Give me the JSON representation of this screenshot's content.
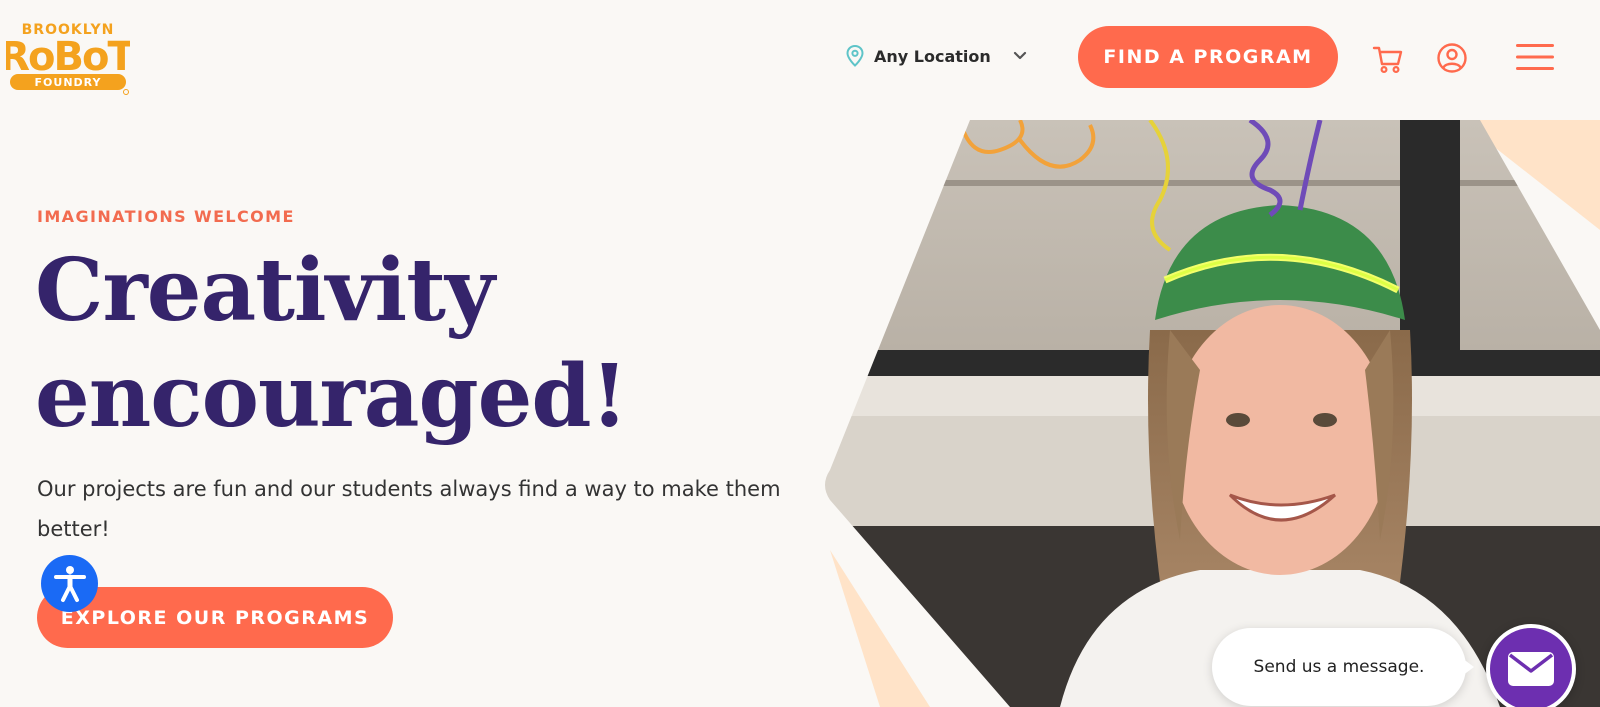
{
  "header": {
    "logo_text": "BROOKLYN ROBOT FOUNDRY",
    "location_label": "Any Location",
    "cta_label": "FIND A PROGRAM",
    "icons": [
      "map-pin-icon",
      "chevron-down-icon",
      "cart-icon",
      "user-icon",
      "hamburger-menu-icon"
    ]
  },
  "hero": {
    "eyebrow": "IMAGINATIONS WELCOME",
    "headline_line1": "Creativity",
    "headline_line2": "encouraged!",
    "description": "Our projects are fun and our students always find a way to make them better!",
    "cta_label": "EXPLORE OUR PROGRAMS"
  },
  "chat": {
    "prompt": "Send us a message."
  },
  "colors": {
    "accent": "#ff6a4d",
    "eyebrow": "#f26b4f",
    "headline": "#35246b",
    "background": "#faf8f5",
    "logo": "#f4a21e",
    "accessibility": "#1a6af5",
    "chat": "#6d2fb0"
  }
}
